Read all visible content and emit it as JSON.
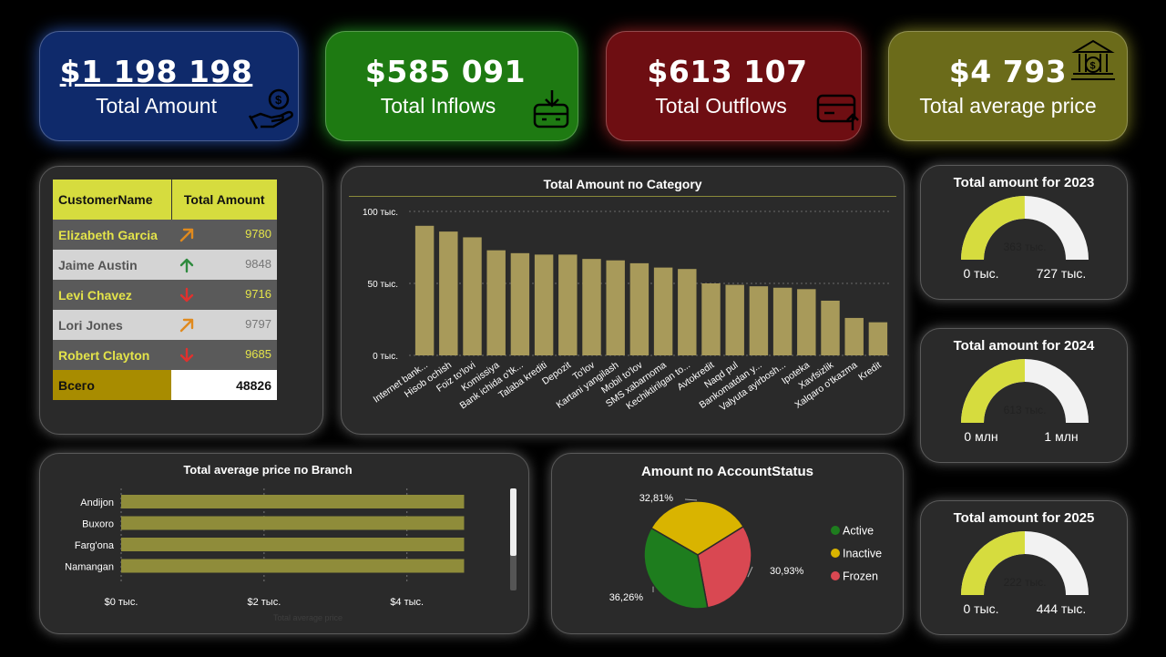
{
  "kpis": [
    {
      "value": "$1 198 198",
      "label": "Total Amount"
    },
    {
      "value": "$585 091",
      "label": "Total Inflows"
    },
    {
      "value": "$613 107",
      "label": "Total Outflows"
    },
    {
      "value": "$4 793",
      "label": "Total average price"
    }
  ],
  "customer_table": {
    "headers": [
      "CustomerName",
      "Total Amount"
    ],
    "rows": [
      {
        "name": "Elizabeth Garcia",
        "trend": "up-right",
        "amount": "9780"
      },
      {
        "name": "Jaime Austin",
        "trend": "up",
        "amount": "9848"
      },
      {
        "name": "Levi Chavez",
        "trend": "down",
        "amount": "9716"
      },
      {
        "name": "Lori Jones",
        "trend": "up-right",
        "amount": "9797"
      },
      {
        "name": "Robert Clayton",
        "trend": "down",
        "amount": "9685"
      }
    ],
    "total_label": "Всего",
    "total_value": "48826"
  },
  "chart_data": [
    {
      "type": "bar",
      "title": "Total Amount по Category",
      "categories": [
        "Internet bank...",
        "Hisob ochish",
        "Foiz to'lovi",
        "Komissiya",
        "Bank ichida o'tk...",
        "Talaba krediti",
        "Depozit",
        "To'lov",
        "Kartani yangilash",
        "Mobil to'lov",
        "SMS xabarnoma",
        "Kechiktirilgan to...",
        "Avtokredit",
        "Naqd pul",
        "Bankomatdan y...",
        "Valyuta ayirbosh...",
        "Ipoteka",
        "Xavfsizlik",
        "Xalqaro o'tkazma",
        "Kredit"
      ],
      "values": [
        90,
        86,
        82,
        73,
        71,
        70,
        70,
        67,
        66,
        64,
        61,
        60,
        50,
        49,
        48,
        47,
        46,
        38,
        26,
        23
      ],
      "ylim": [
        0,
        100
      ],
      "yticks": [
        "100 тыс.",
        "50 тыс.",
        "0 тыс."
      ],
      "color": "#a89a5a"
    },
    {
      "type": "bar",
      "orientation": "horizontal",
      "title": "Total average price по Branch",
      "categories": [
        "Andijon",
        "Buxoro",
        "Farg'ona",
        "Namangan"
      ],
      "values": [
        4.8,
        4.8,
        4.8,
        4.8
      ],
      "xlim": [
        0,
        5.1
      ],
      "xticks": [
        "$0 тыс.",
        "$2 тыс.",
        "$4 тыс."
      ],
      "xtick_values": [
        0,
        2,
        4
      ],
      "xlabel": "Total average price",
      "color": "#8f8c3a"
    },
    {
      "type": "pie",
      "title": "Amount по AccountStatus",
      "slices": [
        {
          "name": "Active",
          "value": 36.26,
          "label": "36,26%",
          "color": "#1e7d1e"
        },
        {
          "name": "Inactive",
          "value": 32.81,
          "label": "32,81%",
          "color": "#d9b400"
        },
        {
          "name": "Frozen",
          "value": 30.93,
          "label": "30,93%",
          "color": "#d94852"
        }
      ]
    },
    {
      "type": "gauge",
      "title": "Total amount for 2023",
      "value": 363,
      "max": 727,
      "value_label": "363 тыс.",
      "min_label": "0 тыс.",
      "max_label": "727 тыс."
    },
    {
      "type": "gauge",
      "title": "Total amount for 2024",
      "value": 613,
      "max": 1226,
      "value_label": "613 тыс.",
      "min_label": "0 млн",
      "max_label": "1 млн"
    },
    {
      "type": "gauge",
      "title": "Total amount for 2025",
      "value": 222,
      "max": 444,
      "value_label": "222 тыс.",
      "min_label": "0 тыс.",
      "max_label": "444 тыс."
    }
  ],
  "colors": {
    "kpi_total": "#0f2a6b",
    "kpi_inflows": "#1e7a12",
    "kpi_outflows": "#6e0e12",
    "kpi_avg": "#6b6b1a",
    "accent_yellow": "#d6dc3e",
    "gauge_fill": "#d6dc3e",
    "gauge_track": "#f2f2f2"
  }
}
